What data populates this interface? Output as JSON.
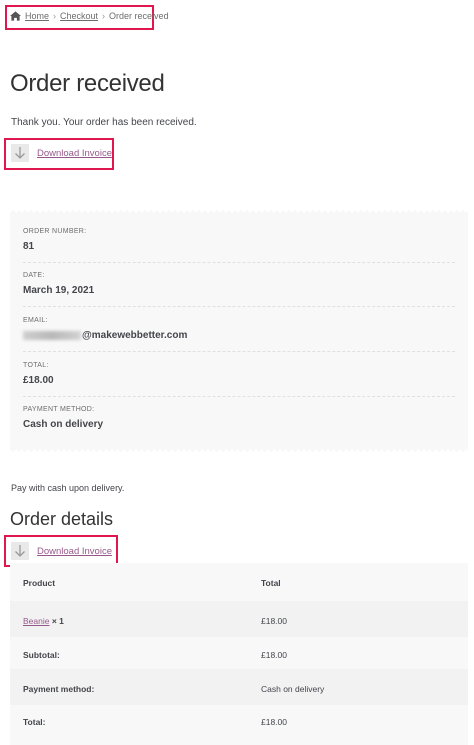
{
  "breadcrumb": {
    "home": "Home",
    "checkout": "Checkout",
    "current": "Order received",
    "separator": "›"
  },
  "page_title": "Order received",
  "thanks_message": "Thank you. Your order has been received.",
  "download_invoice_label": "Download Invoice",
  "overview": {
    "order_number_label": "ORDER NUMBER:",
    "order_number": "81",
    "date_label": "DATE:",
    "date": "March 19, 2021",
    "email_label": "EMAIL:",
    "email_visible": "@makewebbetter.com",
    "total_label": "TOTAL:",
    "total": "£18.00",
    "payment_label": "PAYMENT METHOD:",
    "payment_method": "Cash on delivery"
  },
  "pay_with_text": "Pay with cash upon delivery.",
  "order_details_title": "Order details",
  "table": {
    "header_product": "Product",
    "header_total": "Total",
    "product_name": "Beanie",
    "product_qty": "× 1",
    "product_total": "£18.00",
    "subtotal_label": "Subtotal:",
    "subtotal_value": "£18.00",
    "payment_label": "Payment method:",
    "payment_value": "Cash on delivery",
    "total_label": "Total:",
    "total_value": "£18.00"
  },
  "colors": {
    "highlight": "#e0174f",
    "link": "#96588a"
  },
  "icons": {
    "home": "home-icon",
    "download": "download-arrow-icon"
  }
}
